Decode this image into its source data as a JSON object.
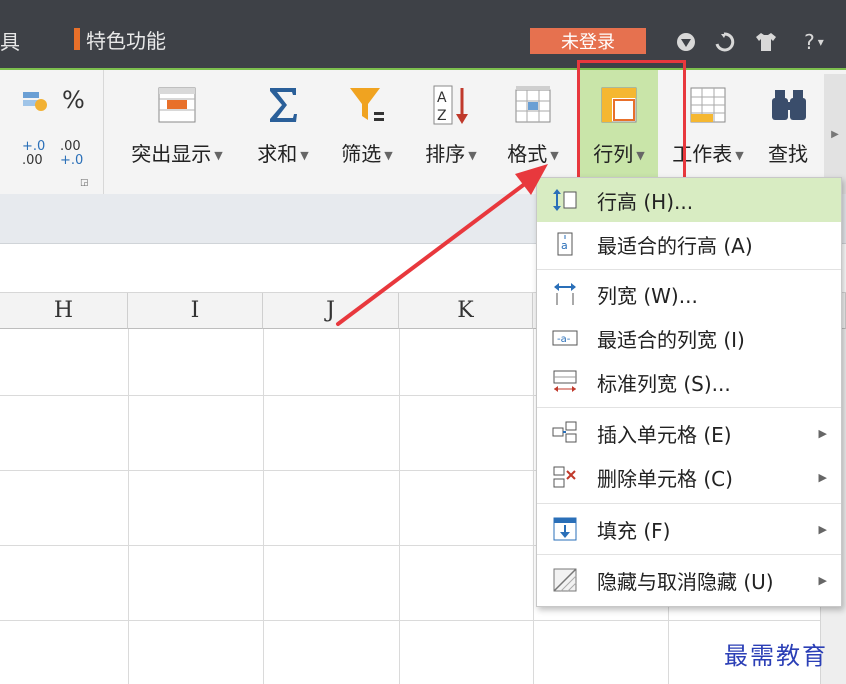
{
  "titlebar": {
    "left_text": "具",
    "feature_label": "特色功能",
    "login_label": "未登录",
    "icons": [
      "shield-icon",
      "refresh-icon",
      "shirt-icon",
      "help-icon"
    ],
    "help_label": "?",
    "colors": {
      "background": "#3e4147",
      "login": "#e6714f",
      "accent_bar": "#e8702a",
      "ribbon_line": "#7dbf4e"
    }
  },
  "ribbon": {
    "percent_label": "%",
    "decimal_increase": {
      "top": "+.0",
      "bottom": ".00"
    },
    "decimal_decrease": {
      "top": ".00",
      "bottom": "+.0"
    },
    "tools": [
      {
        "id": "highlight",
        "label": "突出显示",
        "icon": "highlight-cells-icon"
      },
      {
        "id": "sum",
        "label": "求和",
        "icon": "sigma-icon"
      },
      {
        "id": "filter",
        "label": "筛选",
        "icon": "filter-funnel-icon"
      },
      {
        "id": "sort",
        "label": "排序",
        "icon": "sort-az-icon"
      },
      {
        "id": "format",
        "label": "格式",
        "icon": "format-grid-icon"
      },
      {
        "id": "rowcol",
        "label": "行列",
        "icon": "row-column-icon",
        "active": true
      },
      {
        "id": "worksheet",
        "label": "工作表",
        "icon": "worksheet-icon"
      },
      {
        "id": "find",
        "label": "查找",
        "icon": "binoculars-icon"
      }
    ],
    "active_color": "#c9e5a9",
    "highlight_box_color": "#e8383d"
  },
  "grid": {
    "columns": [
      "H",
      "I",
      "J",
      "K"
    ]
  },
  "menu": {
    "items": [
      {
        "label": "行高 (H)...",
        "icon": "row-height-icon",
        "hover": true,
        "submenu": false
      },
      {
        "label": "最适合的行高 (A)",
        "icon": "autofit-row-icon",
        "submenu": false
      },
      {
        "label": "列宽 (W)...",
        "icon": "column-width-icon",
        "submenu": false
      },
      {
        "label": "最适合的列宽 (I)",
        "icon": "autofit-column-icon",
        "submenu": false
      },
      {
        "label": "标准列宽 (S)...",
        "icon": "standard-width-icon",
        "submenu": false
      },
      {
        "label": "插入单元格 (E)",
        "icon": "insert-cells-icon",
        "submenu": true
      },
      {
        "label": "删除单元格 (C)",
        "icon": "delete-cells-icon",
        "submenu": true
      },
      {
        "label": "填充 (F)",
        "icon": "fill-down-icon",
        "submenu": true
      },
      {
        "label": "隐藏与取消隐藏 (U)",
        "icon": "hide-unhide-icon",
        "submenu": true
      }
    ],
    "hover_color": "#d8ecc2"
  },
  "annotation": {
    "arrow_color": "#e8383d"
  },
  "watermark": {
    "text": "最需教育",
    "color": "#2b3fb6"
  }
}
